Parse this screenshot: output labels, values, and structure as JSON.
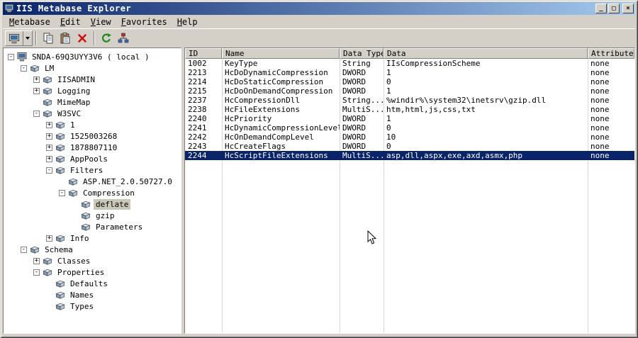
{
  "colors": {
    "titlebar_gradient_start": "#0a246a",
    "titlebar_gradient_end": "#a6caf0",
    "selection_background": "#0a246a",
    "chrome": "#d4d0c8"
  },
  "window": {
    "title": "IIS Metabase Explorer",
    "controls": {
      "minimize": "_",
      "maximize": "□",
      "close": "×"
    }
  },
  "menu": {
    "items": [
      "Metabase",
      "Edit",
      "View",
      "Favorites",
      "Help"
    ]
  },
  "toolbar": {
    "buttons": [
      "connect",
      "copy",
      "paste",
      "delete",
      "refresh",
      "inheritance"
    ]
  },
  "tree": {
    "items": [
      {
        "label": "SNDA-69Q3UYY3V6 ( local )"
      },
      {
        "label": "LM"
      },
      {
        "label": "IISADMIN"
      },
      {
        "label": "Logging"
      },
      {
        "label": "MimeMap"
      },
      {
        "label": "W3SVC"
      },
      {
        "label": "1"
      },
      {
        "label": "1525003268"
      },
      {
        "label": "1878807110"
      },
      {
        "label": "AppPools"
      },
      {
        "label": "Filters"
      },
      {
        "label": "ASP.NET_2.0.50727.0"
      },
      {
        "label": "Compression"
      },
      {
        "label": "deflate",
        "selected": true
      },
      {
        "label": "gzip"
      },
      {
        "label": "Parameters"
      },
      {
        "label": "Info"
      },
      {
        "label": "Schema"
      },
      {
        "label": "Classes"
      },
      {
        "label": "Properties"
      },
      {
        "label": "Defaults"
      },
      {
        "label": "Names"
      },
      {
        "label": "Types"
      }
    ]
  },
  "table": {
    "columns": [
      "ID",
      "Name",
      "Data Type",
      "Data",
      "Attributes"
    ],
    "rows": [
      [
        "1002",
        "KeyType",
        "String",
        "IIsCompressionScheme",
        "none"
      ],
      [
        "2213",
        "HcDoDynamicCompression",
        "DWORD",
        "1",
        "none"
      ],
      [
        "2214",
        "HcDoStaticCompression",
        "DWORD",
        "0",
        "none"
      ],
      [
        "2215",
        "HcDoOnDemandCompression",
        "DWORD",
        "1",
        "none"
      ],
      [
        "2237",
        "HcCompressionDll",
        "String...",
        "%windir%\\system32\\inetsrv\\gzip.dll",
        "none"
      ],
      [
        "2238",
        "HcFileExtensions",
        "MultiS...",
        "htm,html,js,css,txt",
        "none"
      ],
      [
        "2240",
        "HcPriority",
        "DWORD",
        "1",
        "none"
      ],
      [
        "2241",
        "HcDynamicCompressionLevel",
        "DWORD",
        "0",
        "none"
      ],
      [
        "2242",
        "HcOnDemandCompLevel",
        "DWORD",
        "10",
        "none"
      ],
      [
        "2243",
        "HcCreateFlags",
        "DWORD",
        "0",
        "none"
      ],
      [
        "2244",
        "HcScriptFileExtensions",
        "MultiS...",
        "asp,dll,aspx,exe,axd,asmx,php",
        "none"
      ]
    ],
    "selected_row": "2244"
  }
}
